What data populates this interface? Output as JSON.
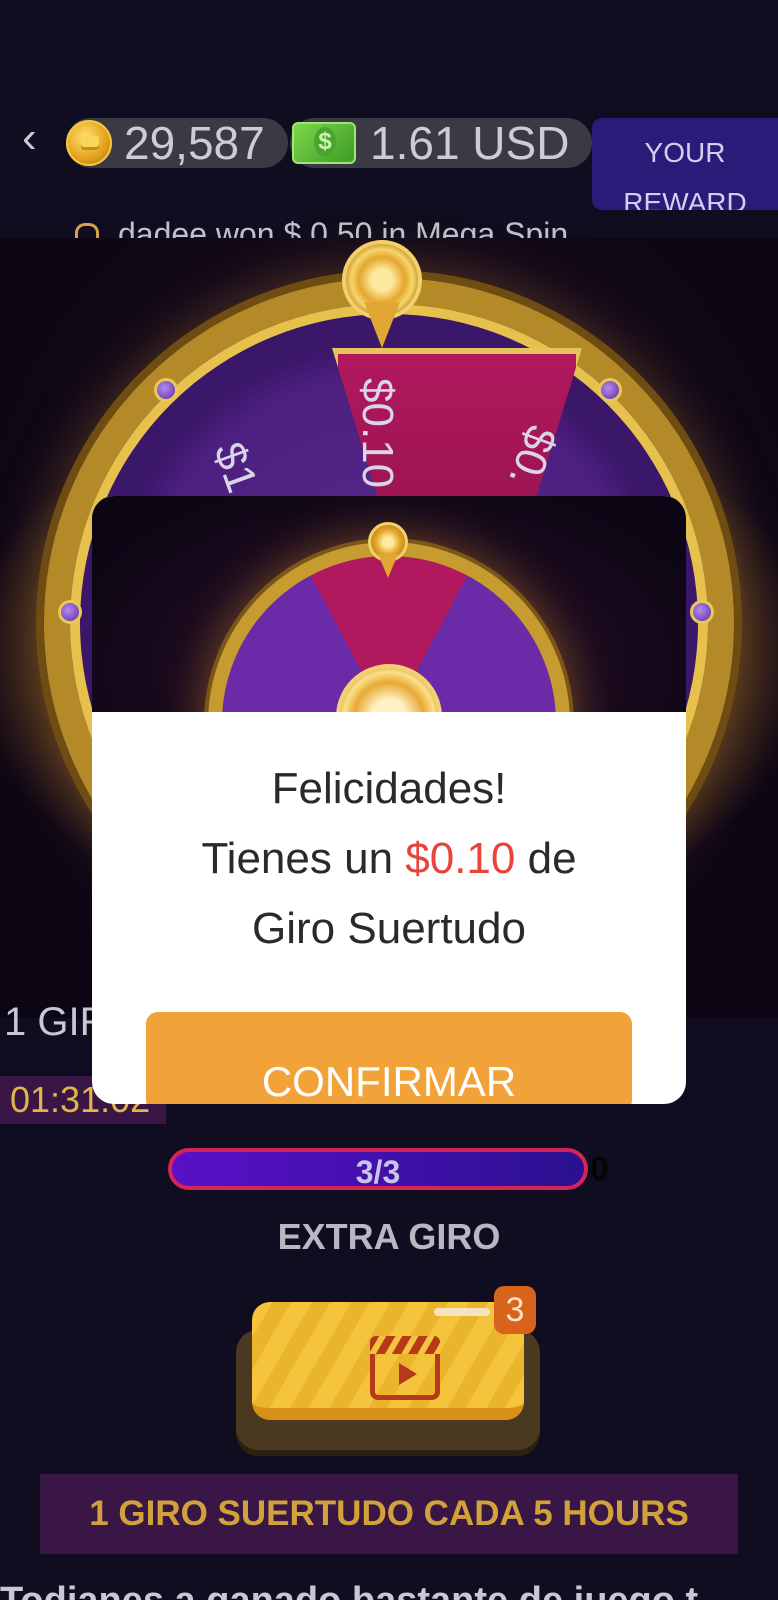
{
  "header": {
    "coins": "29,587",
    "cash": "1.61 USD",
    "reward_btn_line1": "YOUR",
    "reward_btn_line2": "REWARD",
    "ticker": "dadee won $ 0.50 in Mega Spin"
  },
  "wheel": {
    "center_label": "$0.10",
    "left_label": "$1",
    "right_label": "$0."
  },
  "bottom": {
    "giro_label": "1 GIR",
    "timer": "01:31:02",
    "progress": "3/3",
    "progress_tail": "0",
    "extra_label": "EXTRA GIRO",
    "video_badge": "3",
    "banner": "1 GIRO SUERTUDO CADA 5 HOURS",
    "cut_text": "Todianes a ganado bastante de juego t"
  },
  "modal": {
    "title": "Felicidades!",
    "line2_prefix": "Tienes un ",
    "amount": "$0.10",
    "line2_suffix": " de",
    "line3": "Giro Suertudo",
    "confirm_label": "CONFIRMAR"
  },
  "colors": {
    "background": "#0f0d1f",
    "accent_orange": "#f1a33a",
    "amount_red": "#e8443a",
    "banner_gold": "#d2a23a"
  },
  "icons": [
    "back-chevron-icon",
    "coin-icon",
    "cash-icon",
    "bell-icon",
    "clapper-video-icon"
  ]
}
